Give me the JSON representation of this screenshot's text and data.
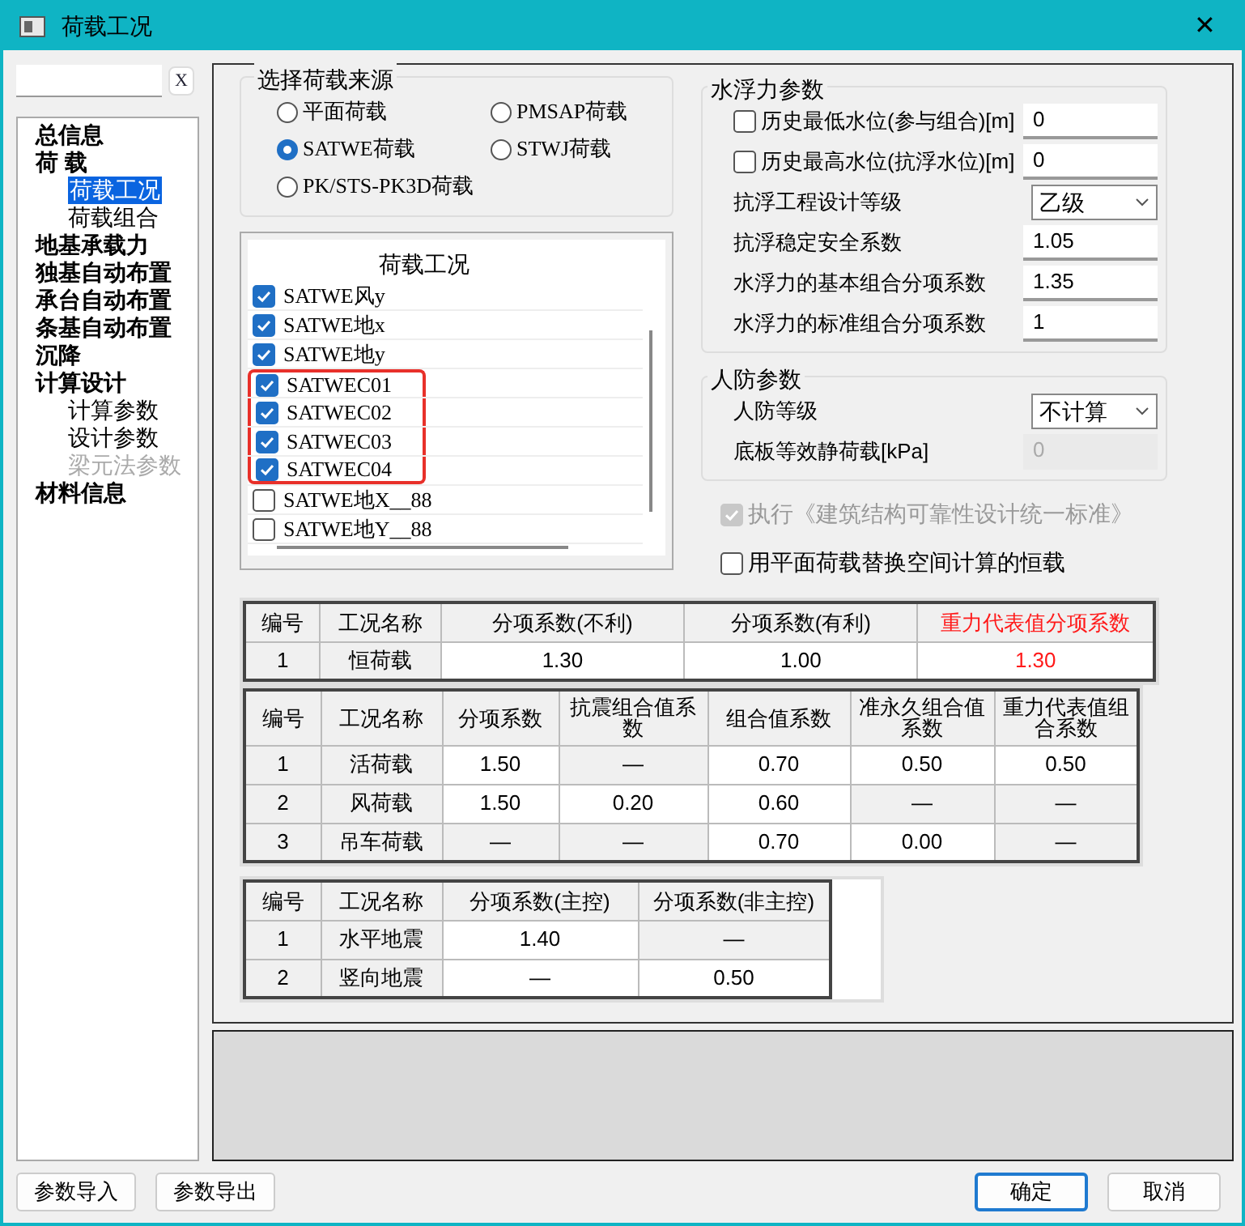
{
  "window": {
    "title": "荷载工况",
    "close": "✕"
  },
  "search": {
    "clear": "X"
  },
  "tree": [
    {
      "label": "总信息",
      "selected": false,
      "disabled": false
    },
    {
      "label": "荷 载",
      "selected": false,
      "disabled": false,
      "children": [
        {
          "label": "荷载工况",
          "selected": true,
          "disabled": false
        },
        {
          "label": "荷载组合",
          "selected": false,
          "disabled": false
        }
      ]
    },
    {
      "label": "地基承载力",
      "selected": false,
      "disabled": false
    },
    {
      "label": "独基自动布置",
      "selected": false,
      "disabled": false
    },
    {
      "label": "承台自动布置",
      "selected": false,
      "disabled": false
    },
    {
      "label": "条基自动布置",
      "selected": false,
      "disabled": false
    },
    {
      "label": "沉降",
      "selected": false,
      "disabled": false
    },
    {
      "label": "计算设计",
      "selected": false,
      "disabled": false,
      "children": [
        {
          "label": "计算参数",
          "selected": false,
          "disabled": false
        },
        {
          "label": "设计参数",
          "selected": false,
          "disabled": false
        },
        {
          "label": "梁元法参数",
          "selected": false,
          "disabled": true
        }
      ]
    },
    {
      "label": "材料信息",
      "selected": false,
      "disabled": false
    }
  ],
  "load_source": {
    "title": "选择荷载来源",
    "options": [
      {
        "label": "平面荷载",
        "selected": false
      },
      {
        "label": "PMSAP荷载",
        "selected": false
      },
      {
        "label": "SATWE荷载",
        "selected": true
      },
      {
        "label": "STWJ荷载",
        "selected": false
      },
      {
        "label": "PK/STS-PK3D荷载",
        "selected": false
      }
    ]
  },
  "load_cases": {
    "header": "荷载工况",
    "items": [
      {
        "label": "SATWE风y",
        "checked": true,
        "highlighted": false
      },
      {
        "label": "SATWE地x",
        "checked": true,
        "highlighted": false
      },
      {
        "label": "SATWE地y",
        "checked": true,
        "highlighted": false
      },
      {
        "label": "SATWEC01",
        "checked": true,
        "highlighted": true
      },
      {
        "label": "SATWEC02",
        "checked": true,
        "highlighted": true
      },
      {
        "label": "SATWEC03",
        "checked": true,
        "highlighted": true
      },
      {
        "label": "SATWEC04",
        "checked": true,
        "highlighted": true
      },
      {
        "label": "SATWE地X__88",
        "checked": false,
        "highlighted": false
      },
      {
        "label": "SATWE地Y__88",
        "checked": false,
        "highlighted": false
      }
    ]
  },
  "groups": [
    {
      "title": "水浮力参数",
      "rows": [
        {
          "kind": "checkbox-field",
          "label": "历史最低水位(参与组合)[m]",
          "checked": false,
          "value": "0"
        },
        {
          "kind": "checkbox-field",
          "label": "历史最高水位(抗浮水位)[m]",
          "checked": false,
          "value": "0"
        },
        {
          "kind": "select",
          "label": "抗浮工程设计等级",
          "value": "乙级"
        },
        {
          "kind": "field",
          "label": "抗浮稳定安全系数",
          "value": "1.05",
          "disabled": false
        },
        {
          "kind": "field",
          "label": "水浮力的基本组合分项系数",
          "value": "1.35",
          "disabled": false
        },
        {
          "kind": "field",
          "label": "水浮力的标准组合分项系数",
          "value": "1",
          "disabled": false
        }
      ]
    },
    {
      "title": "人防参数",
      "rows": [
        {
          "kind": "select",
          "label": "人防等级",
          "value": "不计算"
        },
        {
          "kind": "field",
          "label": "底板等效静荷载[kPa]",
          "value": "0",
          "disabled": true
        }
      ]
    }
  ],
  "options": [
    {
      "label": "执行《建筑结构可靠性设计统一标准》",
      "checked": true,
      "disabled": true
    },
    {
      "label": "用平面荷载替换空间计算的恒载",
      "checked": false,
      "disabled": false
    }
  ],
  "tables": [
    {
      "columns": [
        {
          "label": "编号",
          "highlighted": false
        },
        {
          "label": "工况名称",
          "highlighted": false
        },
        {
          "label": "分项系数(不利)",
          "highlighted": false
        },
        {
          "label": "分项系数(有利)",
          "highlighted": false
        },
        {
          "label": "重力代表值分项系数",
          "highlighted": true
        }
      ],
      "rows": [
        {
          "number": "1",
          "name": "恒荷载",
          "values": [
            "1.30",
            "1.00",
            "1.30"
          ],
          "disabled": [
            false,
            false,
            false
          ]
        }
      ]
    },
    {
      "columns": [
        {
          "label": "编号",
          "highlighted": false
        },
        {
          "label": "工况名称",
          "highlighted": false
        },
        {
          "label": "分项系数",
          "highlighted": false
        },
        {
          "label": "抗震组合值系数",
          "highlighted": false
        },
        {
          "label": "组合值系数",
          "highlighted": false
        },
        {
          "label": "准永久组合值系数",
          "highlighted": false
        },
        {
          "label": "重力代表值组合系数",
          "highlighted": false
        }
      ],
      "rows": [
        {
          "number": "1",
          "name": "活荷载",
          "values": [
            "1.50",
            "—",
            "0.70",
            "0.50",
            "0.50"
          ],
          "disabled": [
            false,
            true,
            false,
            false,
            false
          ]
        },
        {
          "number": "2",
          "name": "风荷载",
          "values": [
            "1.50",
            "0.20",
            "0.60",
            "—",
            "—"
          ],
          "disabled": [
            false,
            false,
            false,
            true,
            true
          ]
        },
        {
          "number": "3",
          "name": "吊车荷载",
          "values": [
            "—",
            "—",
            "0.70",
            "0.00",
            "—"
          ],
          "disabled": [
            true,
            true,
            false,
            false,
            true
          ]
        }
      ]
    },
    {
      "columns": [
        {
          "label": "编号",
          "highlighted": false
        },
        {
          "label": "工况名称",
          "highlighted": false
        },
        {
          "label": "分项系数(主控)",
          "highlighted": false
        },
        {
          "label": "分项系数(非主控)",
          "highlighted": false
        }
      ],
      "rows": [
        {
          "number": "1",
          "name": "水平地震",
          "values": [
            "1.40",
            "—"
          ],
          "disabled": [
            false,
            true
          ]
        },
        {
          "number": "2",
          "name": "竖向地震",
          "values": [
            "—",
            "0.50"
          ],
          "disabled": [
            false,
            false
          ]
        }
      ]
    }
  ],
  "buttons": [
    {
      "label": "参数导入",
      "default": false
    },
    {
      "label": "参数导出",
      "default": false
    },
    {
      "label": "确定",
      "default": true
    },
    {
      "label": "取消",
      "default": false
    }
  ]
}
